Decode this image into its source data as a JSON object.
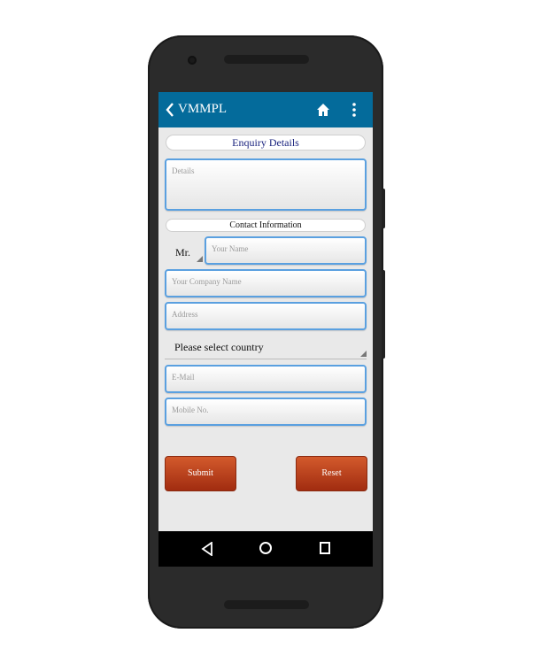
{
  "app": {
    "title": "VMMPL"
  },
  "icons": {
    "back": "chevron-left-icon",
    "home": "home-icon",
    "menu": "more-vert-icon"
  },
  "colors": {
    "app_bar": "#046b9b",
    "field_border": "#5aa0e0",
    "button": "#c0461f",
    "section_title": "#1a237e"
  },
  "form": {
    "enquiry_header": "Enquiry Details",
    "details_placeholder": "Details",
    "contact_header": "Contact Information",
    "salutation_value": "Mr.",
    "name_placeholder": "Your Name",
    "company_placeholder": "Your Company Name",
    "address_placeholder": "Address",
    "country_value": "Please select country",
    "email_placeholder": "E-Mail",
    "mobile_placeholder": "Mobile No."
  },
  "buttons": {
    "submit": "Submit",
    "reset": "Reset"
  }
}
